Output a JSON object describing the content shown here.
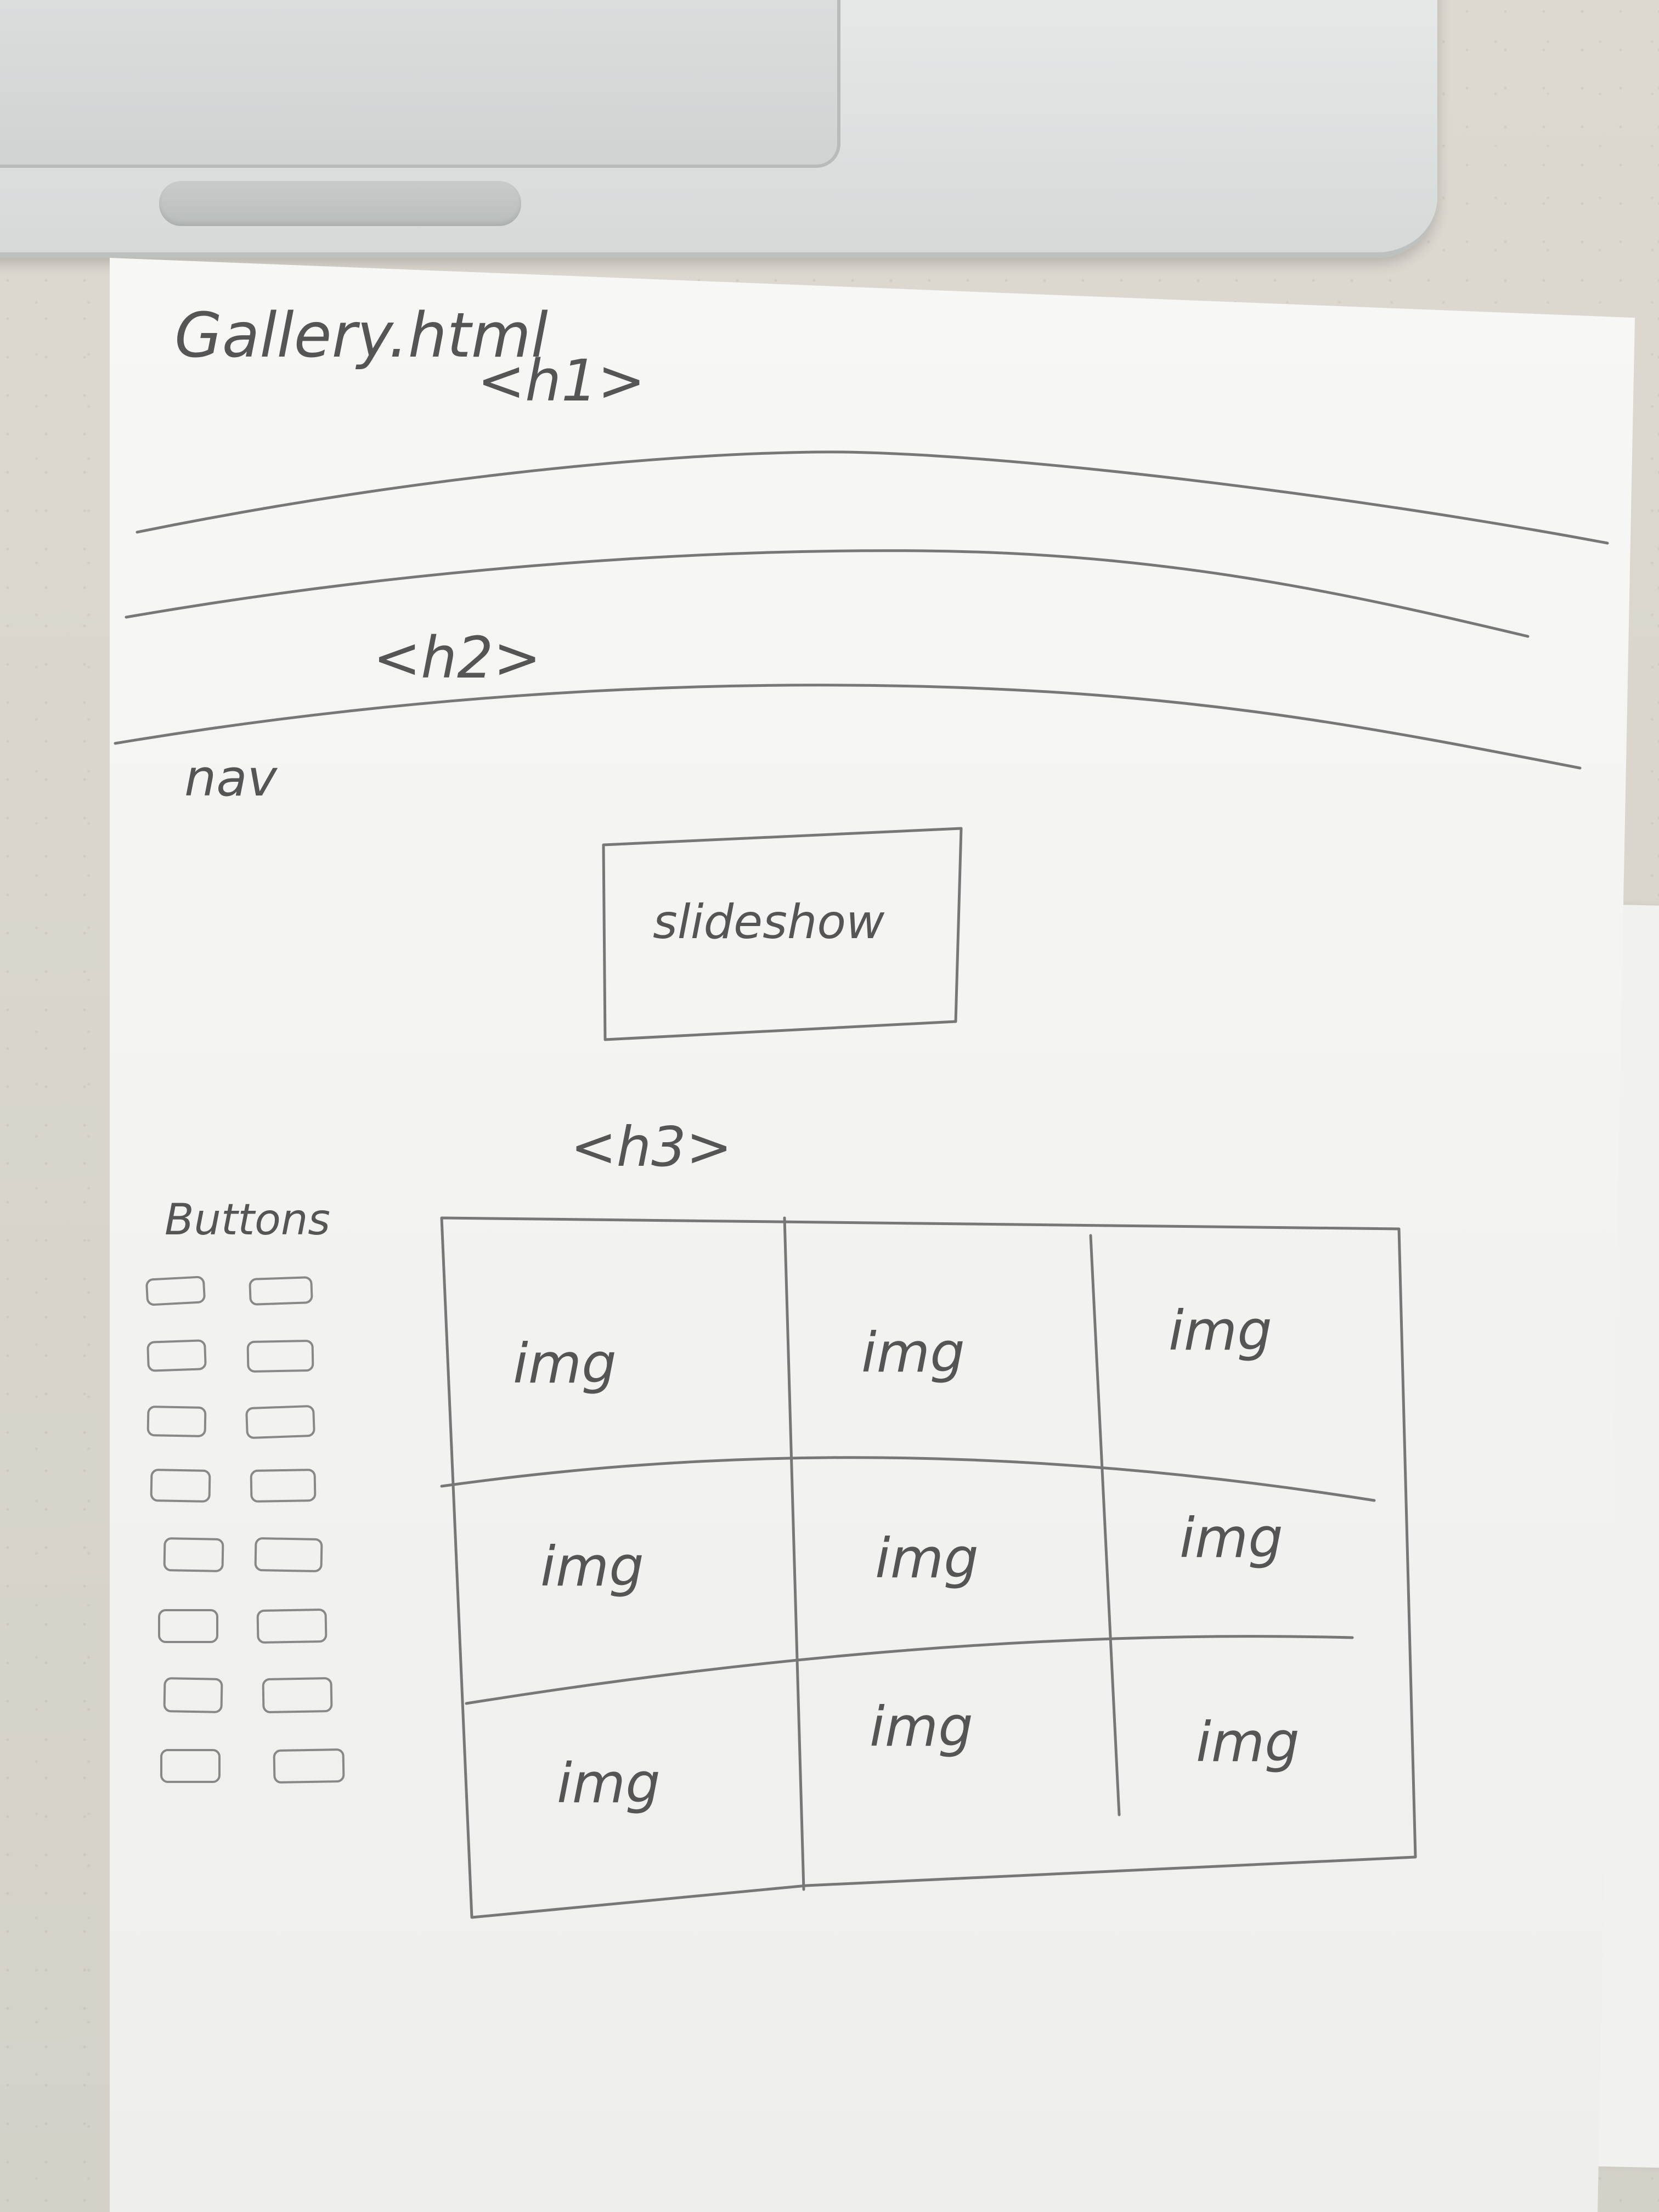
{
  "sketch": {
    "filename": "Gallery.html",
    "h1_label": "<h1>",
    "h2_label": "<h2>",
    "nav_label": "nav",
    "slideshow_label": "slideshow",
    "h3_label": "<h3>",
    "buttons_label": "Buttons",
    "gallery_cells": [
      "img",
      "img",
      "img",
      "img",
      "img",
      "img",
      "img",
      "img",
      "img"
    ]
  }
}
